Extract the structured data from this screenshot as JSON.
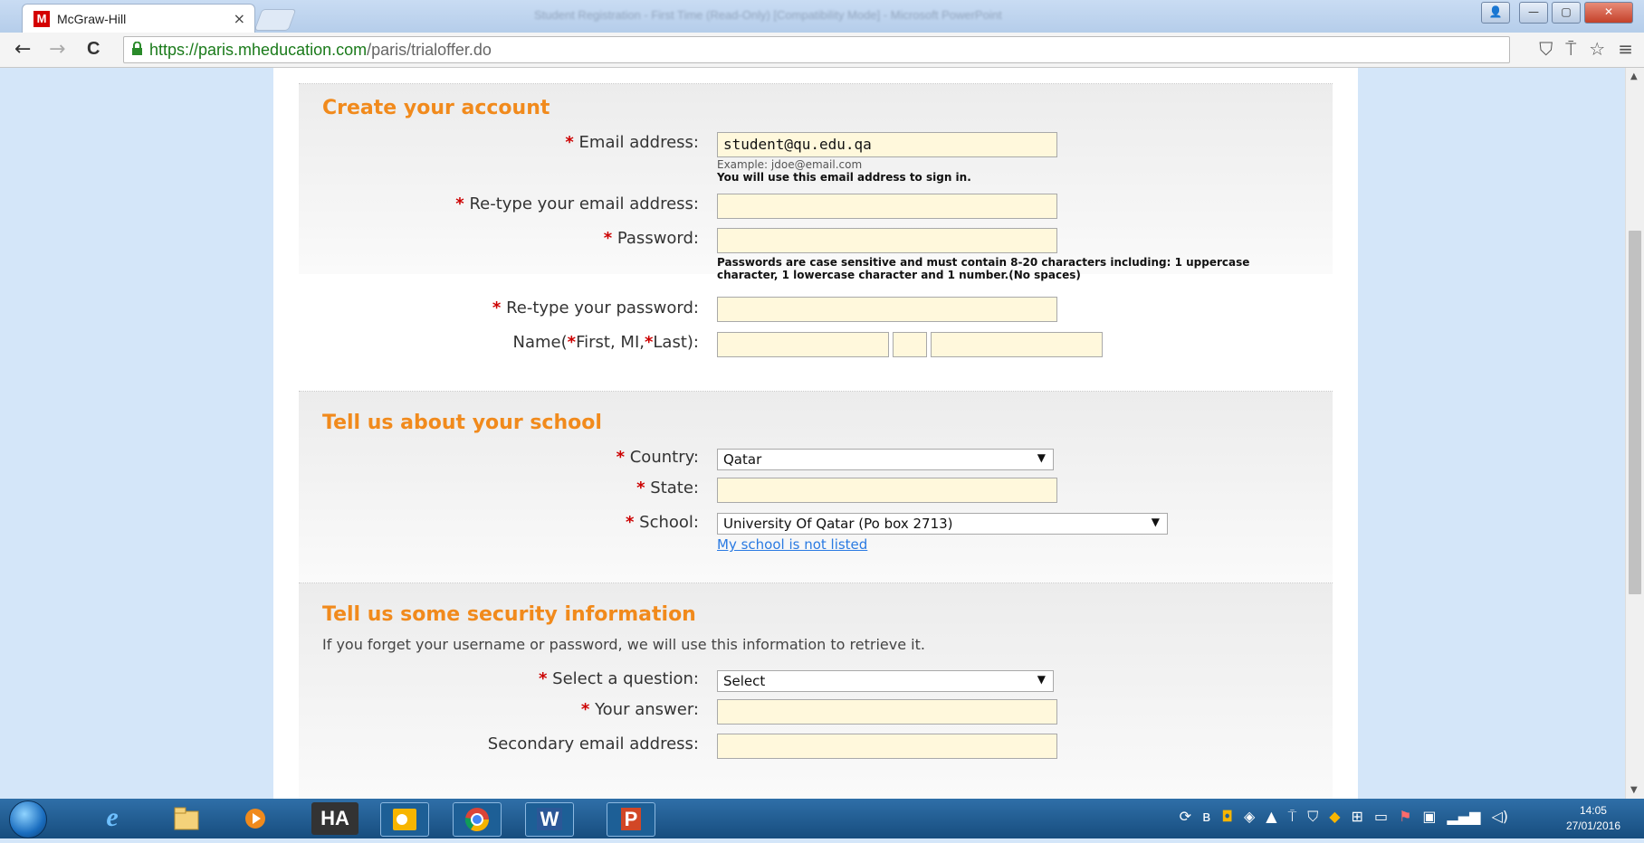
{
  "browser": {
    "tab_title": "McGraw-Hill",
    "tab_logo": "M",
    "window_title": "Student Registration - First Time (Read-Only) [Compatibility Mode] - Microsoft PowerPoint",
    "url_host": "https://paris.mheducation.com",
    "url_path": "/paris/trialoffer.do",
    "back_icon": "←",
    "forward_icon": "→",
    "reload_icon": "C",
    "toolbar_icons": [
      "shield-icon",
      "pin-icon",
      "star-icon",
      "menu-icon"
    ]
  },
  "sections": {
    "account": {
      "title": "Create your account",
      "email_label": "Email address:",
      "email_value": "student@qu.edu.qa",
      "email_hint": "Example: jdoe@email.com",
      "email_note": "You will use this email address to sign in.",
      "retype_email_label": "Re-type your email address:",
      "password_label": "Password:",
      "password_note_1": "Passwords are case sensitive and must contain 8-20 characters including: 1 uppercase",
      "password_note_2": "character, 1 lowercase character and 1 number.(No spaces)",
      "retype_password_label": "Re-type your password:",
      "name_label_prefix": "Name(",
      "name_label_first": "First, MI,",
      "name_label_last": "Last):"
    },
    "school": {
      "title": "Tell us about your school",
      "country_label": "Country:",
      "country_value": "Qatar",
      "state_label": "State:",
      "school_label": "School:",
      "school_value": "University Of Qatar (Po box 2713)",
      "not_listed_link": "My school is not listed"
    },
    "security": {
      "title": "Tell us some security information",
      "description": "If you forget your username or password, we will use this information to retrieve it.",
      "question_label": "Select a question:",
      "question_value": "Select",
      "answer_label": "Your answer:",
      "secondary_email_label": "Secondary email address:"
    }
  },
  "required_marker": "*",
  "taskbar": {
    "items": [
      "e",
      "HA",
      "W",
      "P"
    ],
    "clock_time": "14:05",
    "clock_date": "27/01/2016"
  }
}
